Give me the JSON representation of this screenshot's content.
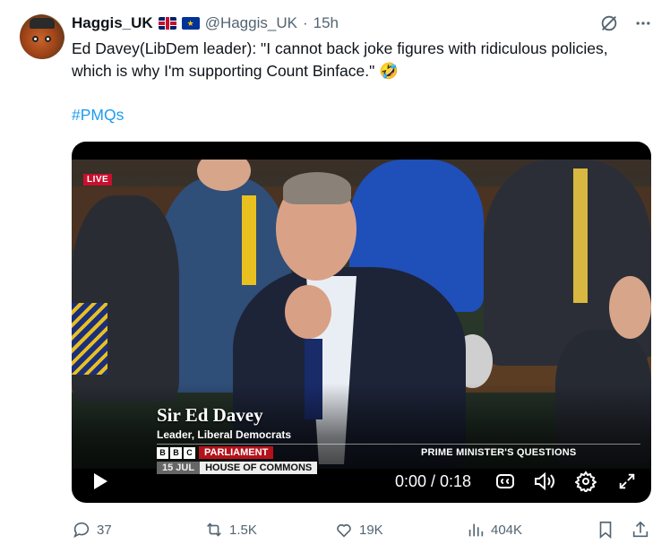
{
  "author": {
    "display_name": "Haggis_UK",
    "flag_1": "uk-flag",
    "flag_2": "eu-flag",
    "handle": "@Haggis_UK",
    "separator": "·",
    "time": "15h"
  },
  "tweet": {
    "text": "Ed Davey(LibDem leader): \"I cannot back joke figures with ridiculous policies, which is why I'm supporting Count Binface.\" 🤣",
    "hashtag": "#PMQs"
  },
  "video": {
    "live_badge": "LIVE",
    "caption_name": "Sir Ed Davey",
    "caption_role": "Leader, Liberal Democrats",
    "bbc_letters": [
      "B",
      "B",
      "C"
    ],
    "channel": "PARLIAMENT",
    "programme": "PRIME MINISTER'S QUESTIONS",
    "date": "15 JUL",
    "location": "HOUSE OF COMMONS",
    "timecode": "0:00 / 0:18"
  },
  "actions": {
    "replies": "37",
    "reposts": "1.5K",
    "likes": "19K",
    "views": "404K"
  },
  "colors": {
    "accent": "#1d9bf0",
    "muted": "#536471",
    "text": "#0f1419",
    "live_red": "#c8102e"
  },
  "icons": {
    "grok": "grok-icon",
    "more": "more-icon",
    "play": "play-icon",
    "captions": "captions-icon",
    "volume": "volume-icon",
    "settings": "gear-icon",
    "fullscreen": "fullscreen-icon",
    "reply": "reply-icon",
    "repost": "repost-icon",
    "like": "heart-icon",
    "views": "views-icon",
    "bookmark": "bookmark-icon",
    "share": "share-icon"
  }
}
